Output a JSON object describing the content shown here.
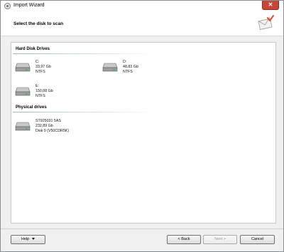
{
  "window": {
    "title": "Import Wizard",
    "close_label": "✕"
  },
  "header": {
    "title": "Select the disk to scan"
  },
  "sections": {
    "hard_disk": {
      "title": "Hard Disk Drives",
      "drives": [
        {
          "line1": "C:",
          "line2": "33,97 Gb",
          "line3": "NTFS"
        },
        {
          "line1": "D:",
          "line2": "48,83 Gb",
          "line3": "NTFS"
        },
        {
          "line1": "E:",
          "line2": "150,08 Gb",
          "line3": "NTFS"
        }
      ]
    },
    "physical": {
      "title": "Physical drives",
      "drives": [
        {
          "line1": "ST925031 5AS",
          "line2": "232,89 Gb",
          "line3": "Disk 0 (V50CDR5K)"
        }
      ]
    }
  },
  "footer": {
    "help_label": "Help",
    "back_label": "< Back",
    "next_label": "Next >",
    "cancel_label": "Cancel"
  }
}
